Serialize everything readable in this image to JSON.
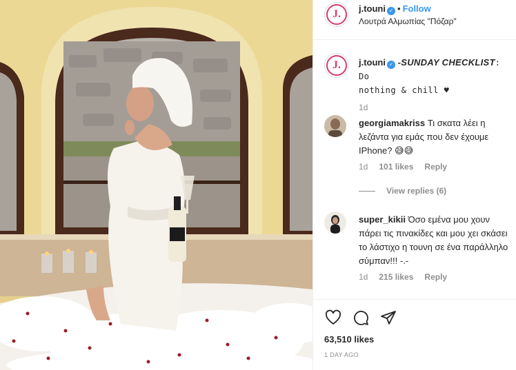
{
  "post": {
    "username": "j.touni",
    "follow_label": "Follow",
    "location": "Λουτρά Αλμωπίας \"Πόζαρ\"",
    "avatar_letter": "J.",
    "caption_prefix": "-SUNDAY CHECKLIST",
    "caption_colon": ": Do",
    "caption_rest": "nothing & chill ♥",
    "caption_time": "1d"
  },
  "comments": [
    {
      "username": "georgiamakriss",
      "text": "Τι σκατα λέει η λεζάντα για εμάς που δεν έχουμε IPhone? 😅😅",
      "time": "1d",
      "likes": "101 likes",
      "reply_label": "Reply",
      "view_replies": "View replies (6)"
    },
    {
      "username": "super_kikii",
      "text": "Όσο εμένα μου χουν πάρει τις πινακίδες και μου χει σκάσει το λάστιχο η τουνη σε ένα παράλληλο σύμπαν!!! -.-",
      "time": "1d",
      "likes": "215 likes",
      "reply_label": "Reply"
    }
  ],
  "footer": {
    "likes": "63,510 likes",
    "date": "1 DAY AGO"
  },
  "icons": [
    "heart-icon",
    "comment-icon",
    "share-icon",
    "verified-badge-icon"
  ],
  "colors": {
    "accent": "#3897f0",
    "brand": "#d63a72",
    "muted": "#8e8e8e"
  }
}
